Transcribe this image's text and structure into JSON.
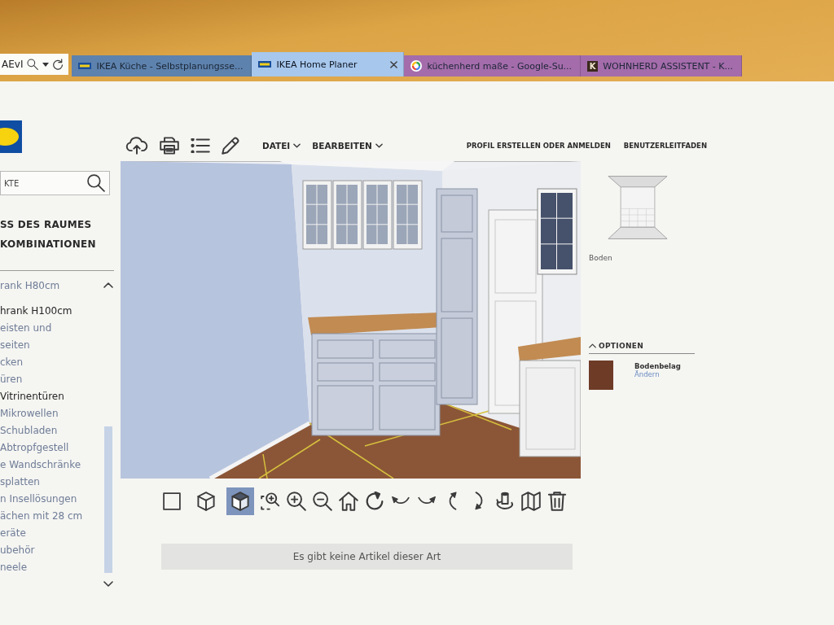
{
  "browser": {
    "address_fragment": "AEvI",
    "tabs": [
      {
        "title": "IKEA Küche - Selbstplanungsse...",
        "color": "#5d82ad",
        "favicon": {
          "kind": "stripe"
        },
        "selected": false
      },
      {
        "title": "IKEA Home Planer",
        "color": "#a7c7ec",
        "favicon": {
          "kind": "stripe"
        },
        "selected": true
      },
      {
        "title": "küchenherd maße - Google-Su...",
        "color": "#a46cab",
        "favicon": {
          "kind": "ring"
        },
        "selected": false
      },
      {
        "title": "WOHNHERD ASSISTENT - K...",
        "color": "#a46cab",
        "favicon": {
          "kind": "letter",
          "text": "K"
        },
        "selected": false
      }
    ]
  },
  "sidebar": {
    "search": {
      "placeholder": "KTE"
    },
    "sections": [
      "SS DES RAUMES",
      "KOMBINATIONEN"
    ],
    "items": [
      {
        "label": "rank H80cm",
        "highlighted": false
      },
      {
        "label": "hrank H100cm",
        "highlighted": true
      },
      {
        "label": "eisten und\nseiten",
        "highlighted": false
      },
      {
        "label": "cken",
        "highlighted": false
      },
      {
        "label": "üren",
        "highlighted": false
      },
      {
        "label": "Vitrinentüren",
        "highlighted": true
      },
      {
        "label": "Mikrowellen",
        "highlighted": false
      },
      {
        "label": "Schubladen",
        "highlighted": false
      },
      {
        "label": "Abtropfgestell",
        "highlighted": false
      },
      {
        "label": "e Wandschränke",
        "highlighted": false
      },
      {
        "label": "splatten",
        "highlighted": false
      },
      {
        "label": "n Insellösungen",
        "highlighted": false
      },
      {
        "label": "ächen mit 28 cm",
        "highlighted": false
      },
      {
        "label": "eräte",
        "highlighted": false
      },
      {
        "label": "ubehör",
        "highlighted": false
      },
      {
        "label": "neele",
        "highlighted": false
      }
    ]
  },
  "toolbar": {
    "menus": [
      "DATEI",
      "BEARBEITEN"
    ],
    "links": [
      "PROFIL ERSTELLEN ODER ANMELDEN",
      "BENUTZERLEITFADEN"
    ]
  },
  "view": {
    "modes": [
      {
        "kind": "plan",
        "selected": false
      },
      {
        "kind": "box",
        "selected": false
      },
      {
        "kind": "solid",
        "selected": true
      }
    ]
  },
  "panel": {
    "preview_label": "Boden",
    "options": {
      "title": "OPTIONEN",
      "expanded": true,
      "items": [
        {
          "name": "Bodenbelag",
          "action": "Ändern",
          "color": "#6e3b27"
        }
      ]
    }
  },
  "message": "Es gibt keine Artikel dieser Art"
}
